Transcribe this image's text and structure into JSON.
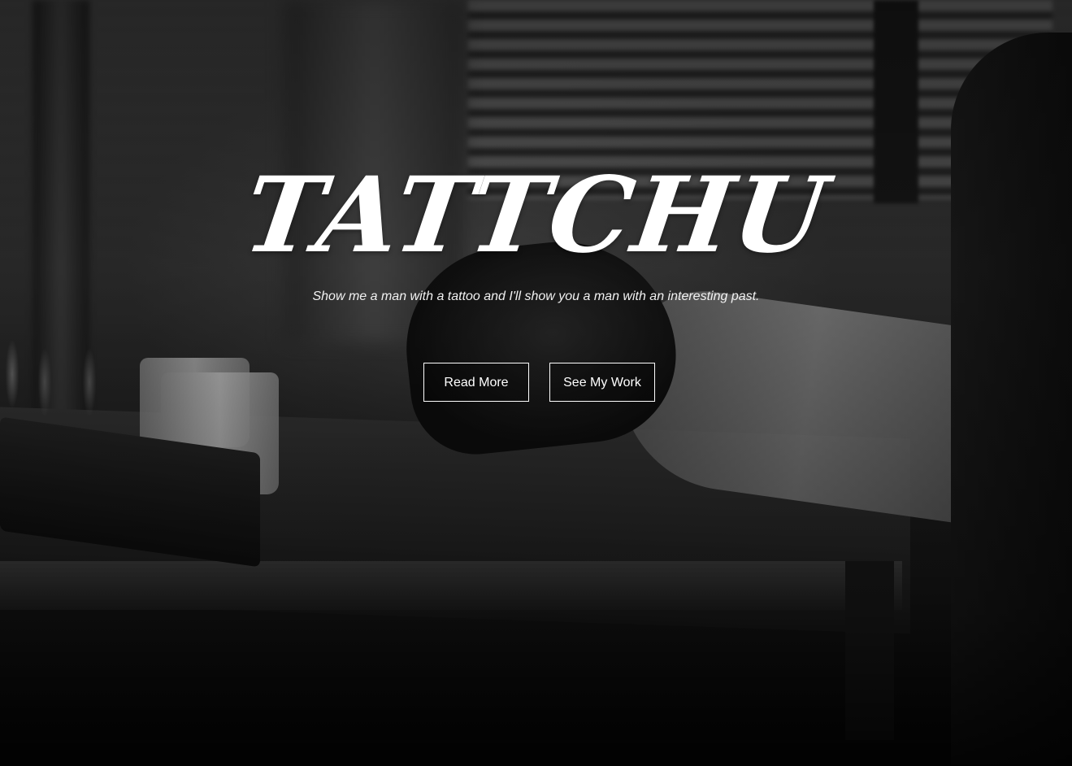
{
  "hero": {
    "title": "TATTCHU",
    "tagline": "Show me a man with a tattoo and I'll show you a man with an interesting past.",
    "buttons": {
      "read_more": "Read More",
      "see_my_work": "See My Work"
    }
  },
  "colors": {
    "text": "#ffffff",
    "overlay": "#000000"
  }
}
